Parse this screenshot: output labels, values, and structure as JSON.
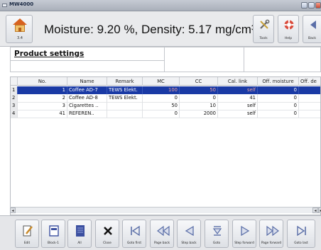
{
  "window": {
    "title": "MW4000"
  },
  "header": {
    "home_version": "3.4",
    "measurement": "Moisture: 9.20 %, Density: 5.17 mg/cm³",
    "buttons": {
      "tools": "Tools",
      "help": "Help",
      "back": "Back"
    }
  },
  "panel": {
    "title": "Product settings"
  },
  "table": {
    "columns": [
      "No.",
      "Name",
      "Remark",
      "MC",
      "CC",
      "Cal. link",
      "Off. moisture",
      "Off. de"
    ],
    "rows": [
      {
        "idx": "1",
        "no": "1",
        "name": "Coffee AD-7",
        "remark": "TEWS Elekt.",
        "mc": "100",
        "cc": "50",
        "cal": "self",
        "off_moist": "0",
        "selected": true
      },
      {
        "idx": "2",
        "no": "2",
        "name": "Coffee AD-8",
        "remark": "TEWS Elekt.",
        "mc": "0",
        "cc": "0",
        "cal": "41",
        "off_moist": "0"
      },
      {
        "idx": "3",
        "no": "3",
        "name": "Cigarettes ..",
        "remark": "",
        "mc": "50",
        "cc": "10",
        "cal": "self",
        "off_moist": "0"
      },
      {
        "idx": "4",
        "no": "41",
        "name": "REFEREN..",
        "remark": "",
        "mc": "0",
        "cc": "2000",
        "cal": "self",
        "off_moist": "0"
      }
    ]
  },
  "footer": {
    "buttons": [
      "Edit",
      "Block-1",
      "All",
      "Close",
      "Goto first",
      "Page back",
      "Step back",
      "Goto",
      "Step forward",
      "Page forward",
      "Goto last"
    ]
  },
  "colors": {
    "selection": "#1a3aa5",
    "home_roof": "#d7621f"
  }
}
